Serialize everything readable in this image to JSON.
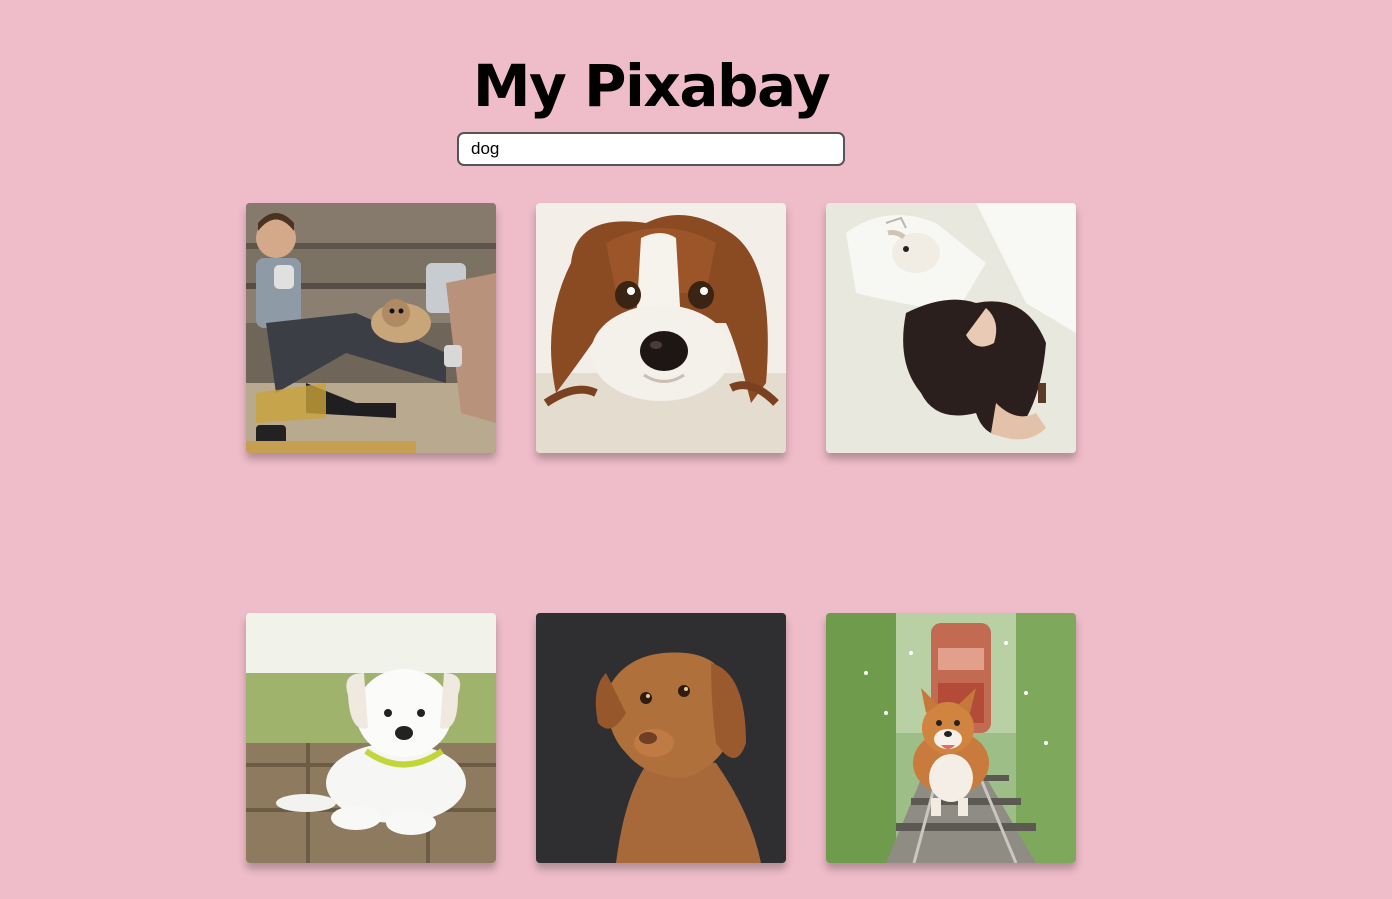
{
  "header": {
    "title": "My Pixabay"
  },
  "search": {
    "value": "dog"
  },
  "results": [
    {
      "subject": "man-and-woman-with-pug-image"
    },
    {
      "subject": "cavalier-spaniel-image"
    },
    {
      "subject": "woman-lying-with-dog-image"
    },
    {
      "subject": "white-puppy-image"
    },
    {
      "subject": "vizsla-dog-image"
    },
    {
      "subject": "corgi-on-tracks-image"
    }
  ],
  "colors": {
    "background": "#efbcc9",
    "title": "#000000",
    "input_border": "#555555"
  }
}
